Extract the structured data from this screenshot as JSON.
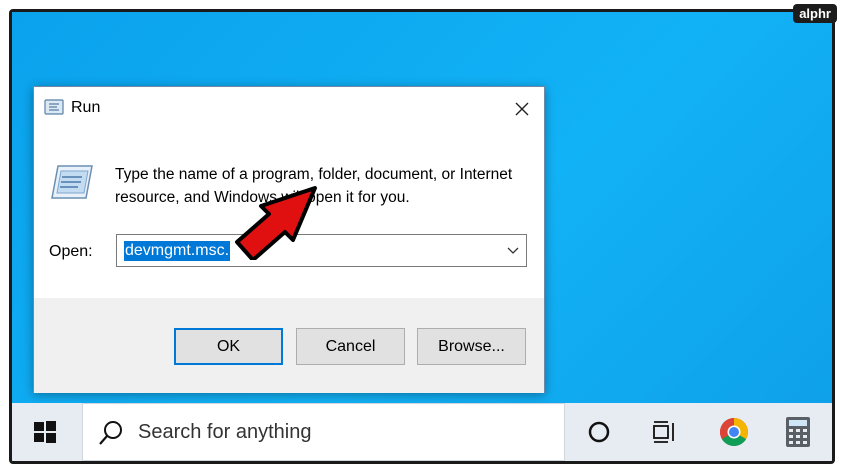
{
  "watermark": "alphr",
  "dialog": {
    "title": "Run",
    "description": "Type the name of a program, folder, document, or Internet resource, and Windows will open it for you.",
    "open_label": "Open:",
    "open_value": "devmgmt.msc.",
    "buttons": {
      "ok": "OK",
      "cancel": "Cancel",
      "browse": "Browse..."
    }
  },
  "taskbar": {
    "search_placeholder": "Search for anything",
    "icons": [
      "windows-start-icon",
      "search-icon",
      "cortana-icon",
      "task-view-icon",
      "chrome-icon",
      "calculator-icon"
    ]
  },
  "colors": {
    "desktop": "#0aa2ec",
    "accent": "#0078d7",
    "arrow": "#e01010"
  }
}
